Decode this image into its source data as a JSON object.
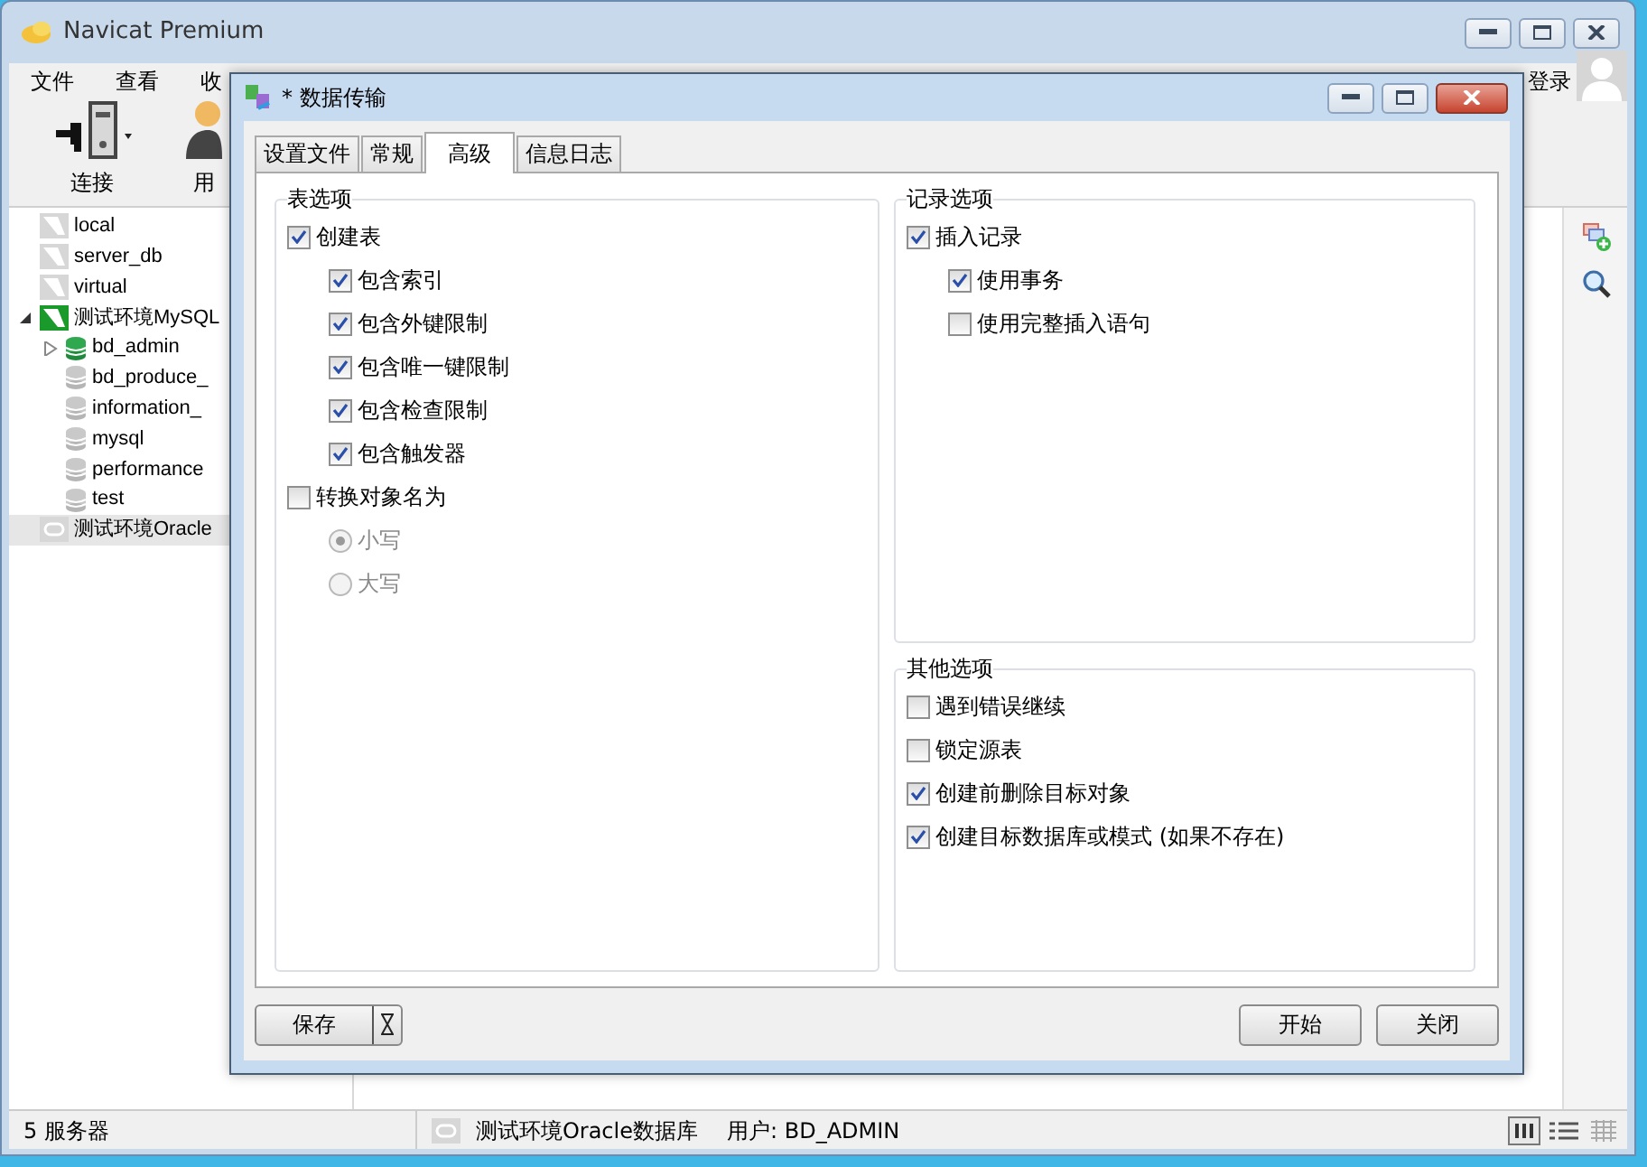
{
  "main_window": {
    "title": "Navicat Premium",
    "menu": [
      "文件",
      "查看",
      "收"
    ],
    "login": "登录",
    "toolbar": [
      {
        "label": "连接",
        "kind": "connect"
      },
      {
        "label": "用",
        "kind": "user"
      }
    ],
    "tree": [
      {
        "label": "local",
        "kind": "server",
        "connected": false,
        "selected": false
      },
      {
        "label": "server_db",
        "kind": "server",
        "connected": false,
        "selected": false
      },
      {
        "label": "virtual",
        "kind": "server",
        "connected": false,
        "selected": false
      },
      {
        "label": "测试环境MySQL",
        "kind": "mysql",
        "connected": true,
        "selected": false,
        "children": [
          {
            "label": "bd_admin",
            "kind": "database",
            "connected": true,
            "selected": false
          },
          {
            "label": "bd_produce_",
            "kind": "database",
            "connected": false,
            "selected": false
          },
          {
            "label": "information_",
            "kind": "database",
            "connected": false,
            "selected": false
          },
          {
            "label": "mysql",
            "kind": "database",
            "connected": false,
            "selected": false
          },
          {
            "label": "performance",
            "kind": "database",
            "connected": false,
            "selected": false
          },
          {
            "label": "test",
            "kind": "database",
            "connected": false,
            "selected": false
          }
        ]
      },
      {
        "label": "测试环境Oracle",
        "kind": "oracle",
        "connected": false,
        "selected": true
      }
    ],
    "status_bar": {
      "count": "5 服务器",
      "connection": "测试环境Oracle数据库",
      "user": "用户: BD_ADMIN"
    }
  },
  "dialog": {
    "title": "* 数据传输",
    "tabs": [
      {
        "label": "设置文件",
        "selected": false
      },
      {
        "label": "常规",
        "selected": false
      },
      {
        "label": "高级",
        "selected": true
      },
      {
        "label": "信息日志",
        "selected": false
      }
    ],
    "table_options": {
      "title": "表选项",
      "items": [
        {
          "kind": "checkbox",
          "label": "创建表",
          "checked": true,
          "children": [
            {
              "kind": "checkbox",
              "label": "包含索引",
              "checked": true
            },
            {
              "kind": "checkbox",
              "label": "包含外键限制",
              "checked": true
            },
            {
              "kind": "checkbox",
              "label": "包含唯一键限制",
              "checked": true
            },
            {
              "kind": "checkbox",
              "label": "包含检查限制",
              "checked": true
            },
            {
              "kind": "checkbox",
              "label": "包含触发器",
              "checked": true
            }
          ]
        },
        {
          "kind": "checkbox",
          "label": "转换对象名为",
          "checked": false,
          "children": [
            {
              "kind": "radio",
              "label": "小写",
              "selected": true,
              "disabled": true
            },
            {
              "kind": "radio",
              "label": "大写",
              "selected": false,
              "disabled": true
            }
          ]
        }
      ]
    },
    "record_options": {
      "title": "记录选项",
      "items": [
        {
          "kind": "checkbox",
          "label": "插入记录",
          "checked": true,
          "children": [
            {
              "kind": "checkbox",
              "label": "使用事务",
              "checked": true
            },
            {
              "kind": "checkbox",
              "label": "使用完整插入语句",
              "checked": false
            }
          ]
        }
      ]
    },
    "other_options": {
      "title": "其他选项",
      "items": [
        {
          "kind": "checkbox",
          "label": "遇到错误继续",
          "checked": false
        },
        {
          "kind": "checkbox",
          "label": "锁定源表",
          "checked": false
        },
        {
          "kind": "checkbox",
          "label": "创建前删除目标对象",
          "checked": true
        },
        {
          "kind": "checkbox",
          "label": "创建目标数据库或模式 (如果不存在)",
          "checked": true
        }
      ]
    },
    "save_button": "保存",
    "buttons": [
      "开始",
      "关闭"
    ]
  }
}
